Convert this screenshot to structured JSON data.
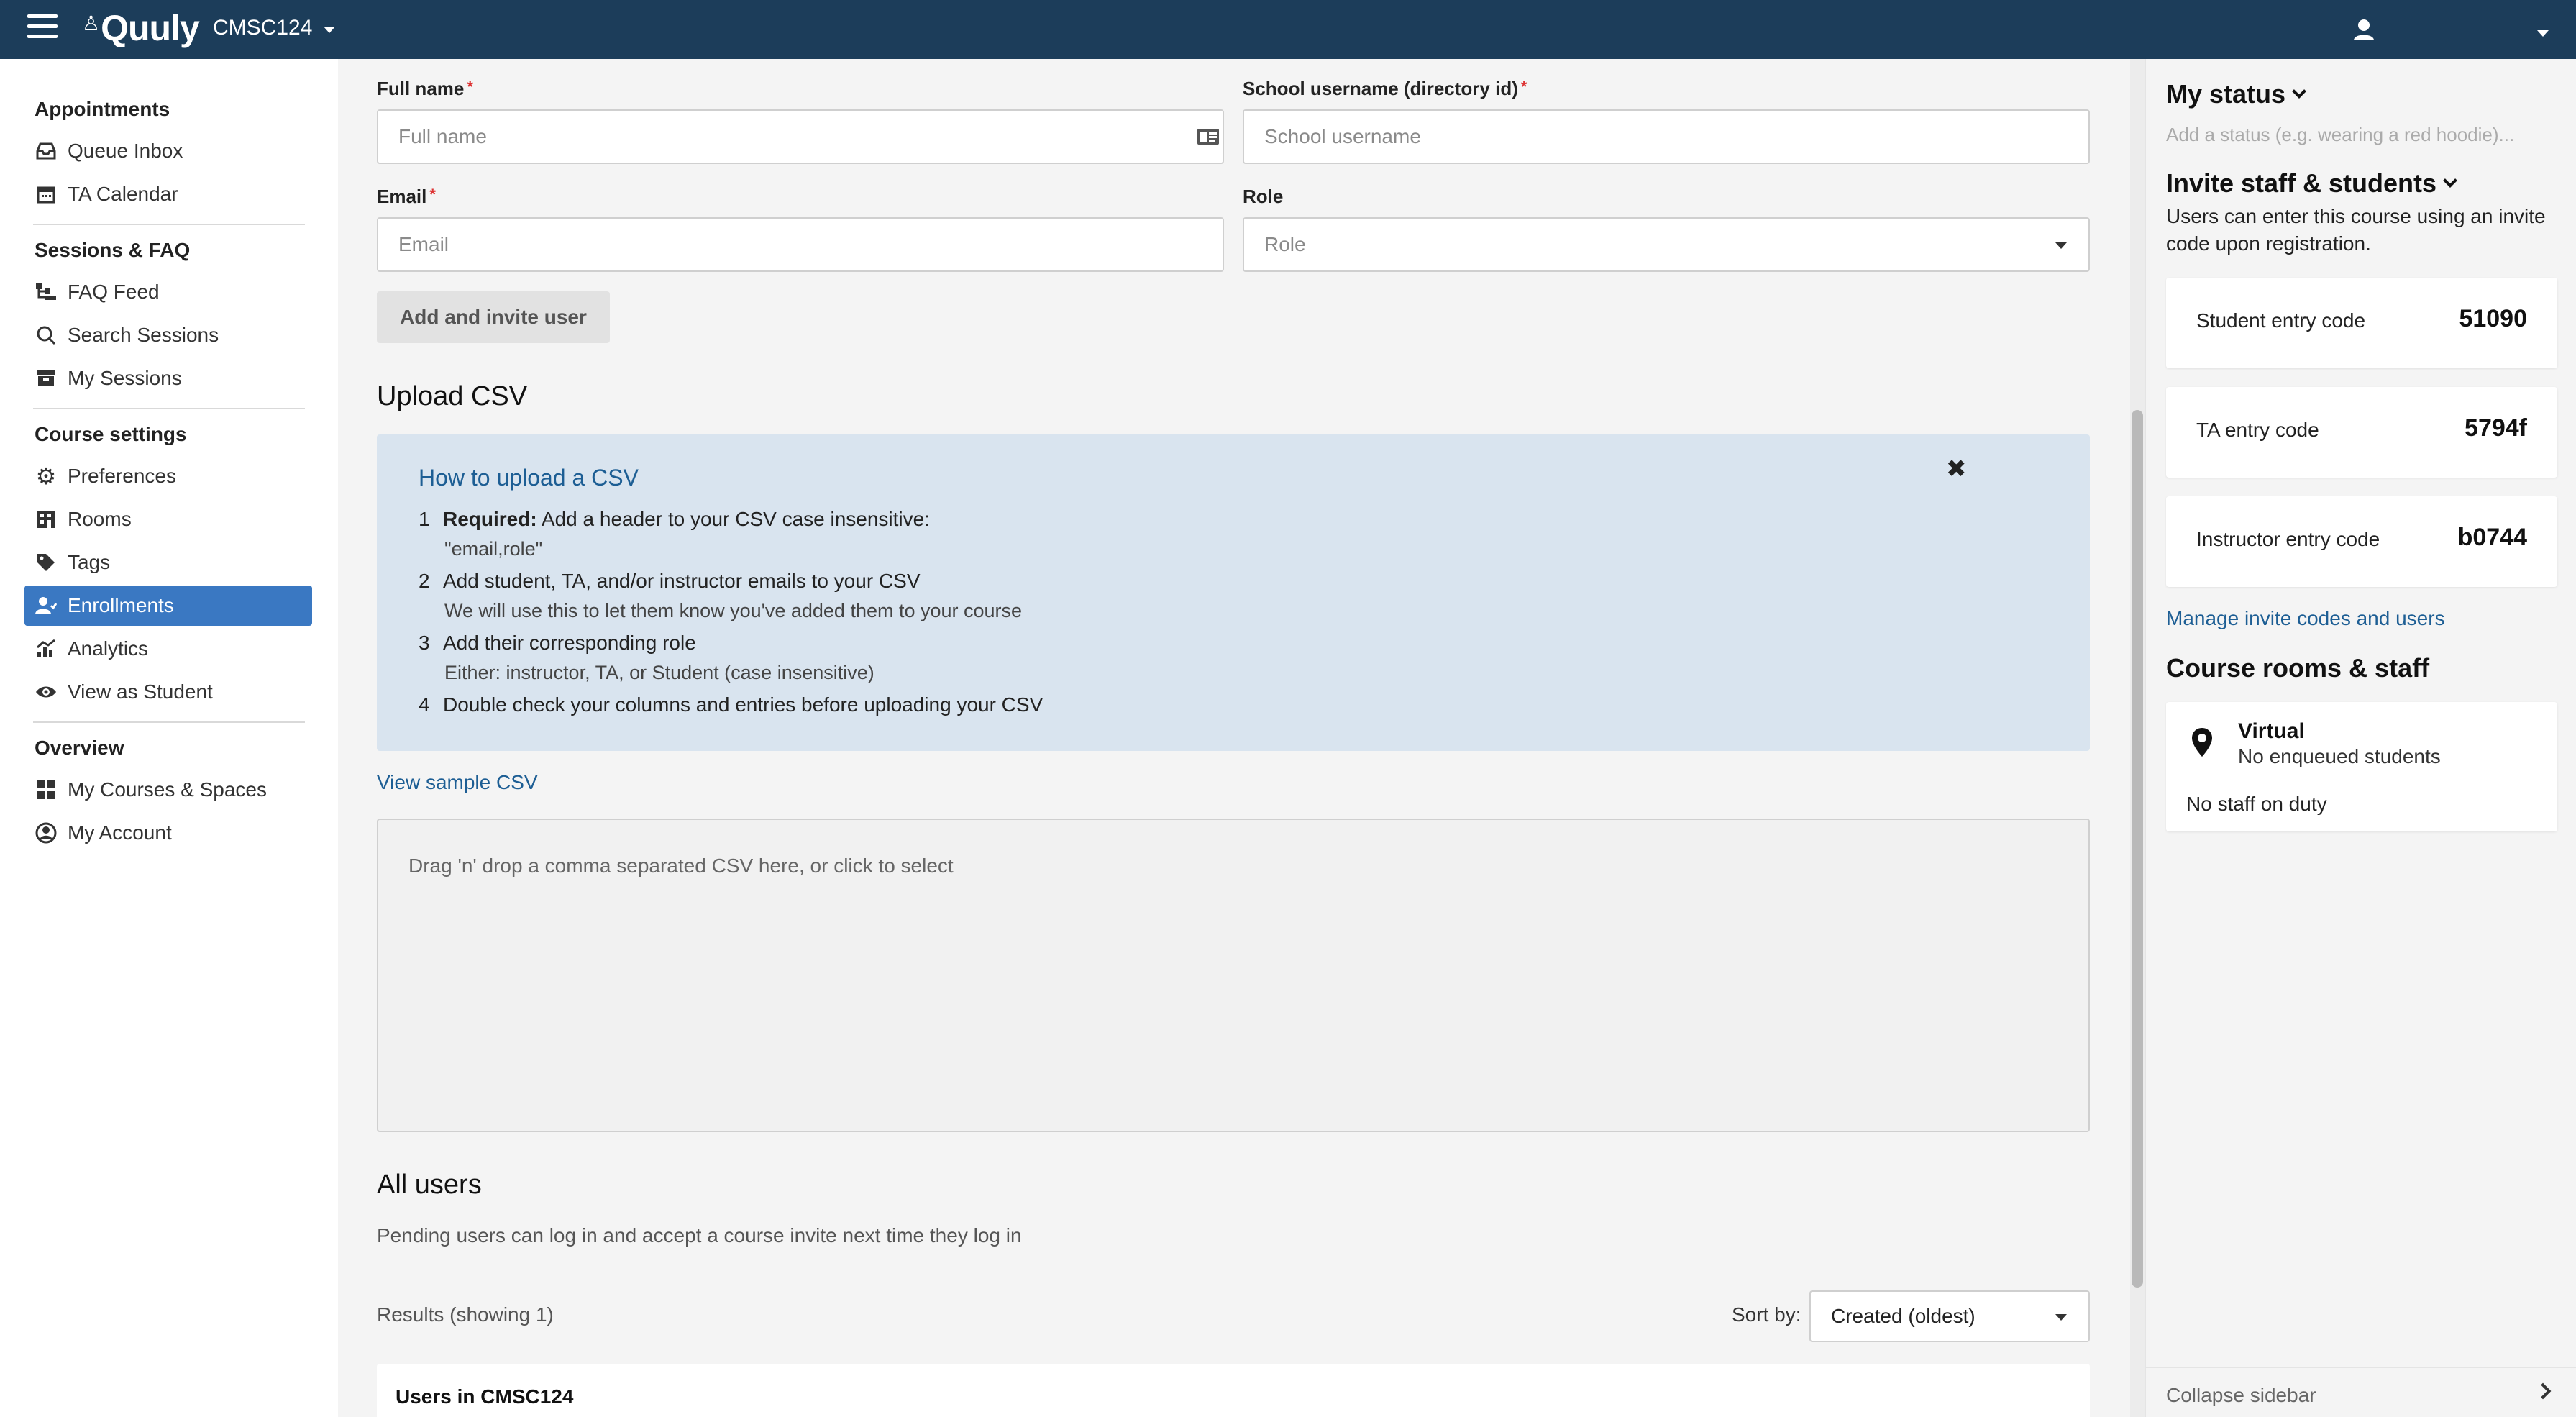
{
  "topbar": {
    "logo": "Quuly",
    "course": "CMSC124"
  },
  "sidebar": {
    "sections": [
      {
        "heading": "Appointments",
        "items": [
          {
            "label": "Queue Inbox",
            "icon": "inbox-icon"
          },
          {
            "label": "TA Calendar",
            "icon": "calendar-icon"
          }
        ]
      },
      {
        "heading": "Sessions & FAQ",
        "items": [
          {
            "label": "FAQ Feed",
            "icon": "feed-icon"
          },
          {
            "label": "Search Sessions",
            "icon": "search-icon"
          },
          {
            "label": "My Sessions",
            "icon": "archive-icon"
          }
        ]
      },
      {
        "heading": "Course settings",
        "items": [
          {
            "label": "Preferences",
            "icon": "gear-icon"
          },
          {
            "label": "Rooms",
            "icon": "building-icon"
          },
          {
            "label": "Tags",
            "icon": "tag-icon"
          },
          {
            "label": "Enrollments",
            "icon": "user-group-icon"
          },
          {
            "label": "Analytics",
            "icon": "chart-icon"
          },
          {
            "label": "View as Student",
            "icon": "eye-icon"
          }
        ]
      },
      {
        "heading": "Overview",
        "items": [
          {
            "label": "My Courses & Spaces",
            "icon": "grid-icon"
          },
          {
            "label": "My Account",
            "icon": "account-icon"
          }
        ]
      }
    ],
    "active": "Enrollments"
  },
  "form": {
    "full_name_label": "Full name",
    "full_name_placeholder": "Full name",
    "username_label": "School username (directory id)",
    "username_placeholder": "School username",
    "email_label": "Email",
    "email_placeholder": "Email",
    "role_label": "Role",
    "role_placeholder": "Role",
    "add_button": "Add and invite user",
    "required_mark": "*"
  },
  "upload": {
    "heading": "Upload CSV",
    "info_title": "How to upload a CSV",
    "close": "✖",
    "steps": [
      {
        "num": "1",
        "bold": "Required:",
        "text": " Add a header to your CSV case insensitive:",
        "sub": "\"email,role\""
      },
      {
        "num": "2",
        "bold": "",
        "text": "Add student, TA, and/or instructor emails to your CSV",
        "sub": "We will use this to let them know you've added them to your course"
      },
      {
        "num": "3",
        "bold": "",
        "text": "Add their corresponding role",
        "sub": "Either: instructor, TA, or Student (case insensitive)"
      },
      {
        "num": "4",
        "bold": "",
        "text": "Double check your columns and entries before uploading your CSV",
        "sub": ""
      }
    ],
    "sample_link": "View sample CSV",
    "dropzone_text": "Drag 'n' drop a comma separated CSV here, or click to select"
  },
  "users": {
    "heading": "All users",
    "subtext": "Pending users can log in and accept a course invite next time they log in",
    "results": "Results (showing 1)",
    "sort_label": "Sort by:",
    "sort_value": "Created (oldest)",
    "card_title": "Users in CMSC124"
  },
  "right": {
    "status_heading": "My status",
    "status_placeholder": "Add a status (e.g. wearing a red hoodie)...",
    "invite_heading": "Invite staff & students",
    "invite_text": "Users can enter this course using an invite code upon registration.",
    "codes": [
      {
        "label": "Student entry code",
        "value": "51090"
      },
      {
        "label": "TA entry code",
        "value": "5794f"
      },
      {
        "label": "Instructor entry code",
        "value": "b0744"
      }
    ],
    "manage_link": "Manage invite codes and users",
    "rooms_heading": "Course rooms & staff",
    "room_name": "Virtual",
    "room_status": "No enqueued students",
    "room_staff": "No staff on duty",
    "collapse": "Collapse sidebar"
  }
}
